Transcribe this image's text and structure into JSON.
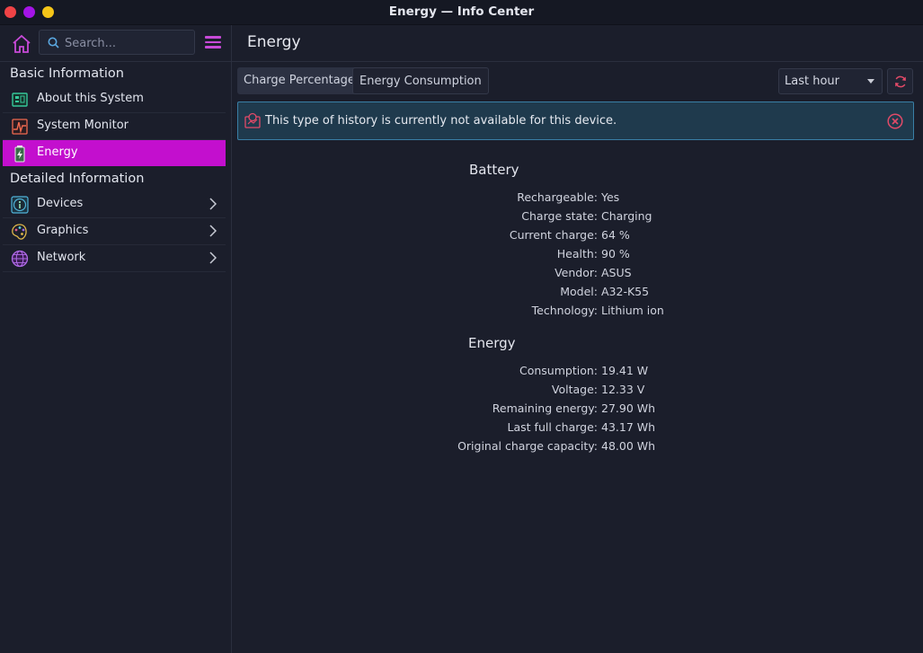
{
  "window": {
    "title": "Energy — Info Center"
  },
  "sidebar": {
    "search_placeholder": "Search...",
    "sections": {
      "basic": "Basic Information",
      "detailed": "Detailed Information"
    },
    "items": [
      {
        "label": "About this System",
        "icon": "computer-board-icon"
      },
      {
        "label": "System Monitor",
        "icon": "system-monitor-icon"
      },
      {
        "label": "Energy",
        "icon": "battery-icon",
        "active": true
      },
      {
        "label": "Devices",
        "icon": "info-icon",
        "has_children": true
      },
      {
        "label": "Graphics",
        "icon": "palette-icon",
        "has_children": true
      },
      {
        "label": "Network",
        "icon": "globe-icon",
        "has_children": true
      }
    ]
  },
  "main": {
    "title": "Energy",
    "tabs": [
      "Charge Percentage",
      "Energy Consumption"
    ],
    "timespan": "Last hour",
    "banner_text": "This type of history is currently not available for this device.",
    "battery": {
      "heading": "Battery",
      "rows": [
        {
          "key": "Rechargeable:",
          "value": "Yes"
        },
        {
          "key": "Charge state:",
          "value": "Charging"
        },
        {
          "key": "Current charge:",
          "value": "64 %"
        },
        {
          "key": "Health:",
          "value": "90 %"
        },
        {
          "key": "Vendor:",
          "value": "ASUS"
        },
        {
          "key": "Model:",
          "value": "A32-K55"
        },
        {
          "key": "Technology:",
          "value": "Lithium ion"
        }
      ]
    },
    "energy": {
      "heading": "Energy",
      "rows": [
        {
          "key": "Consumption:",
          "value": "19.41 W"
        },
        {
          "key": "Voltage:",
          "value": "12.33 V"
        },
        {
          "key": "Remaining energy:",
          "value": "27.90 Wh"
        },
        {
          "key": "Last full charge:",
          "value": "43.17 Wh"
        },
        {
          "key": "Original charge capacity:",
          "value": "48.00 Wh"
        }
      ]
    }
  },
  "colors": {
    "accent": "#c30fce",
    "background": "#1b1e2b",
    "banner_bg": "#1f3a4d",
    "banner_border": "#3a7fa6",
    "close_red": "#ef4346",
    "minimize_purple": "#a414e6",
    "maximize_yellow": "#f5c518"
  }
}
